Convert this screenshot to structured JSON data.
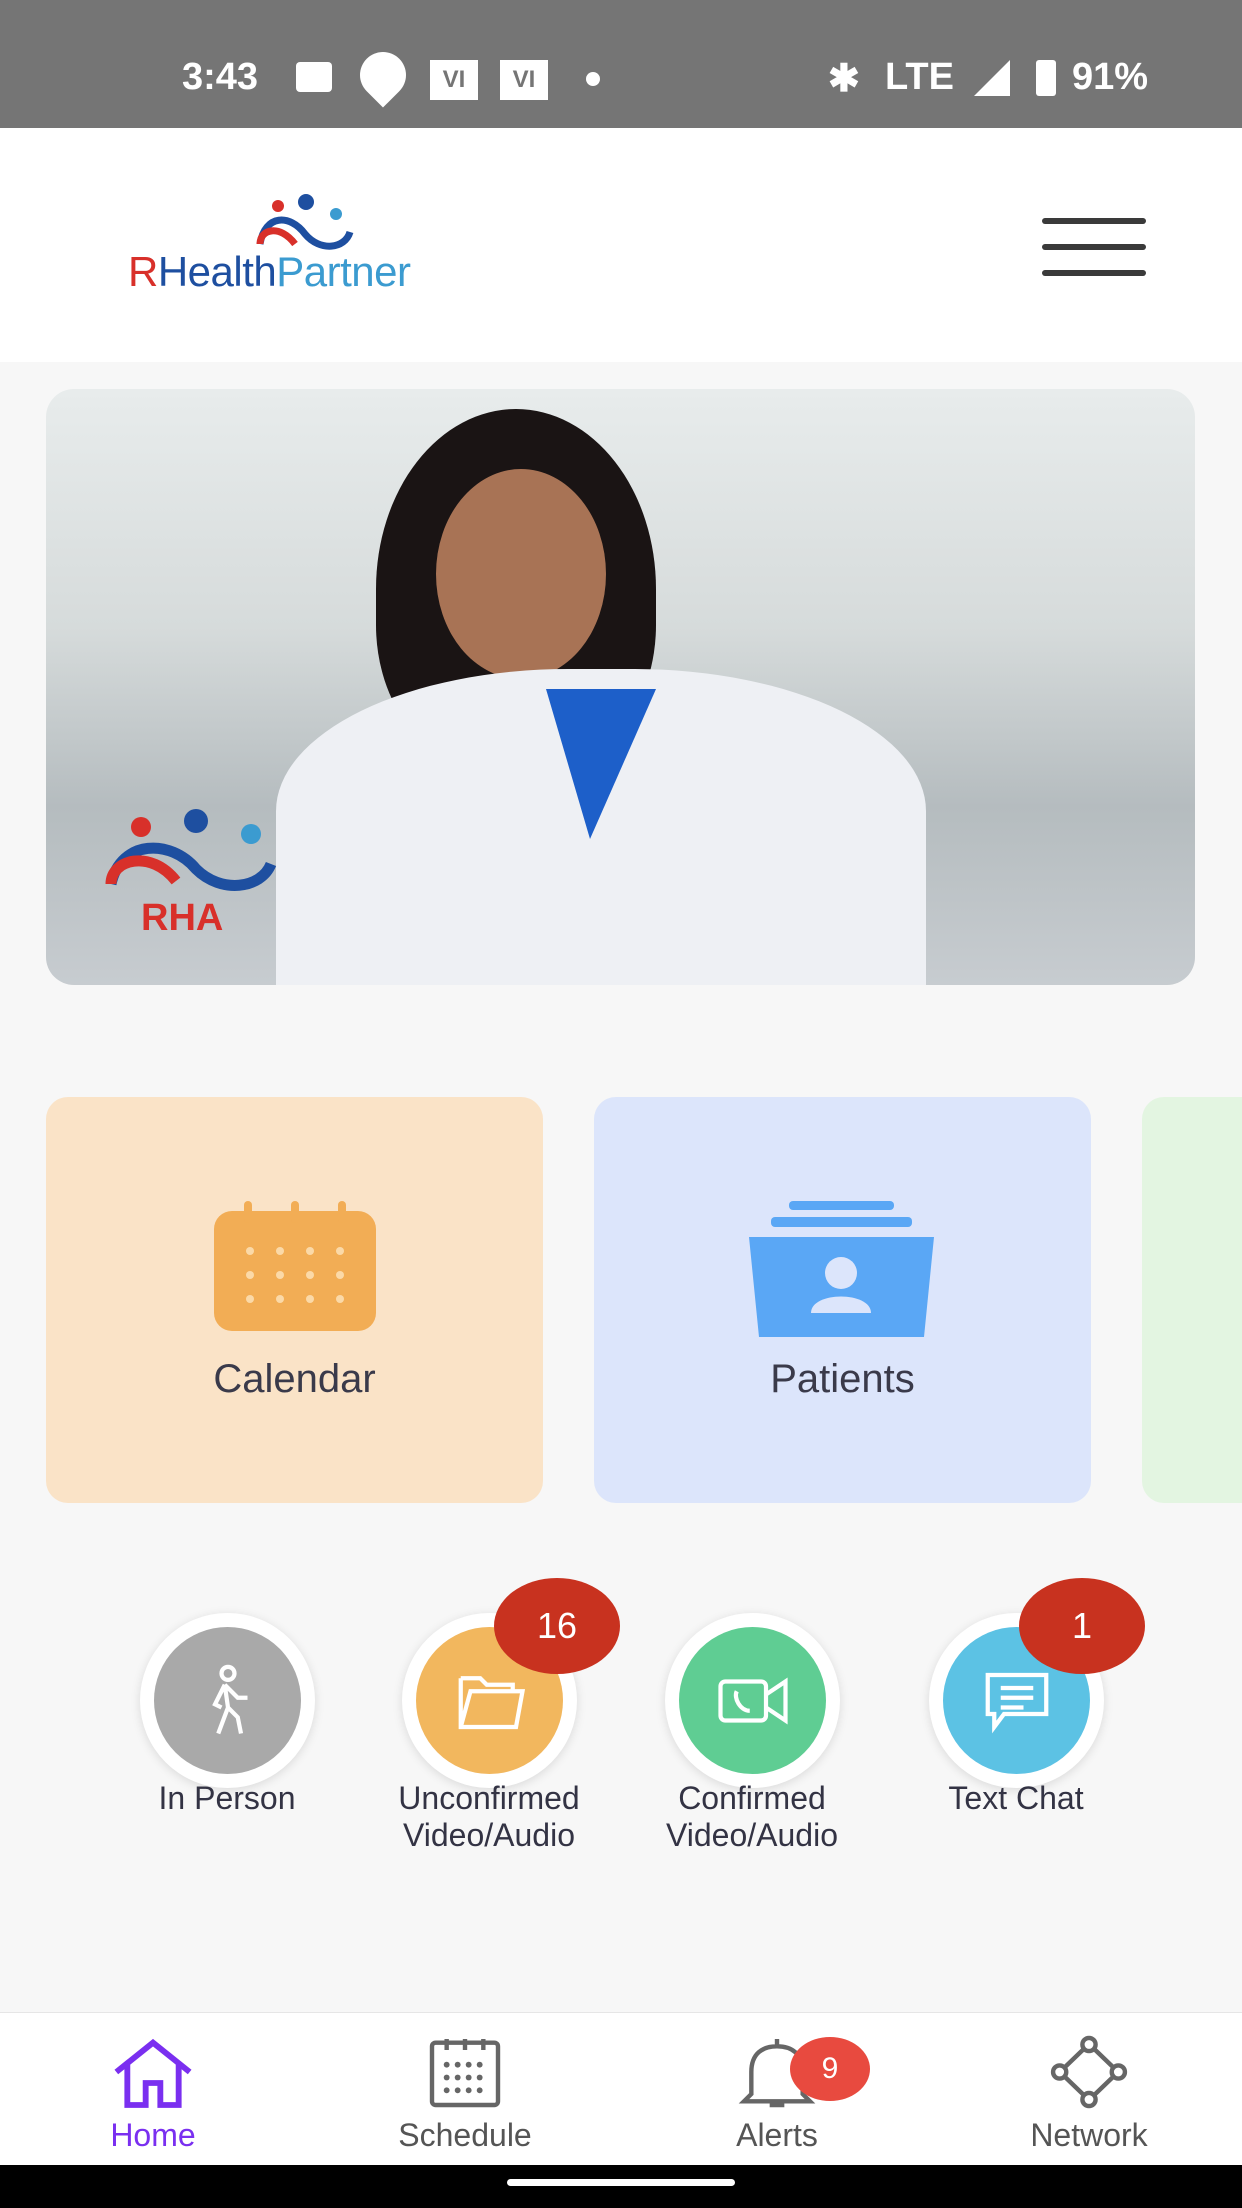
{
  "status_bar": {
    "time": "3:43",
    "carrier_icons": [
      "VI",
      "VI"
    ],
    "network": "LTE",
    "battery": "91%"
  },
  "header": {
    "logo": {
      "part1": "R",
      "part2": "Health",
      "part3": "Partner"
    },
    "menu_icon": "hamburger-icon"
  },
  "banner": {
    "logo_text": "RHA"
  },
  "cards": [
    {
      "label": "Calendar",
      "color": "#fae3c7",
      "icon": "calendar-icon"
    },
    {
      "label": "Patients",
      "color": "#dce5fb",
      "icon": "patients-folder-icon"
    },
    {
      "label": "",
      "color": "#e3f5e1"
    }
  ],
  "quick_actions": [
    {
      "label": "In Person",
      "color": "#a9a9a9",
      "icon": "walking-person-icon"
    },
    {
      "label_line1": "Unconfirmed",
      "label_line2": "Video/Audio",
      "color": "#f2b75e",
      "icon": "folder-icon",
      "badge": "16"
    },
    {
      "label_line1": "Confirmed",
      "label_line2": "Video/Audio",
      "color": "#5fcd93",
      "icon": "video-call-icon"
    },
    {
      "label": "Text Chat",
      "color": "#5cc2e4",
      "icon": "chat-icon",
      "badge": "1"
    }
  ],
  "bottom_nav": [
    {
      "label": "Home",
      "active": true,
      "color": "#7a2ff0"
    },
    {
      "label": "Schedule"
    },
    {
      "label": "Alerts",
      "badge": "9"
    },
    {
      "label": "Network"
    }
  ]
}
